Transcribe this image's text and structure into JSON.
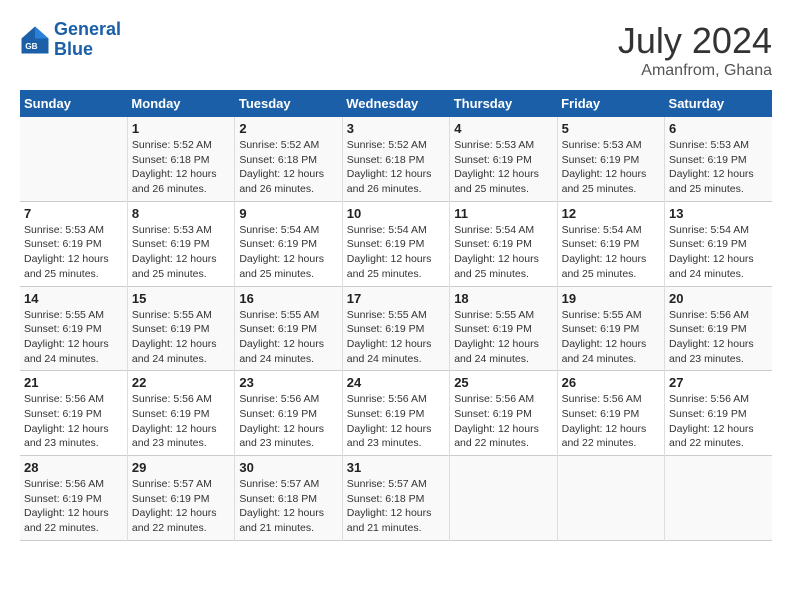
{
  "header": {
    "logo_line1": "General",
    "logo_line2": "Blue",
    "title": "July 2024",
    "subtitle": "Amanfrom, Ghana"
  },
  "weekdays": [
    "Sunday",
    "Monday",
    "Tuesday",
    "Wednesday",
    "Thursday",
    "Friday",
    "Saturday"
  ],
  "weeks": [
    [
      null,
      {
        "day": "1",
        "sunrise": "5:52 AM",
        "sunset": "6:18 PM",
        "daylight": "12 hours and 26 minutes."
      },
      {
        "day": "2",
        "sunrise": "5:52 AM",
        "sunset": "6:18 PM",
        "daylight": "12 hours and 26 minutes."
      },
      {
        "day": "3",
        "sunrise": "5:52 AM",
        "sunset": "6:18 PM",
        "daylight": "12 hours and 26 minutes."
      },
      {
        "day": "4",
        "sunrise": "5:53 AM",
        "sunset": "6:19 PM",
        "daylight": "12 hours and 25 minutes."
      },
      {
        "day": "5",
        "sunrise": "5:53 AM",
        "sunset": "6:19 PM",
        "daylight": "12 hours and 25 minutes."
      },
      {
        "day": "6",
        "sunrise": "5:53 AM",
        "sunset": "6:19 PM",
        "daylight": "12 hours and 25 minutes."
      }
    ],
    [
      {
        "day": "7",
        "sunrise": "5:53 AM",
        "sunset": "6:19 PM",
        "daylight": "12 hours and 25 minutes."
      },
      {
        "day": "8",
        "sunrise": "5:53 AM",
        "sunset": "6:19 PM",
        "daylight": "12 hours and 25 minutes."
      },
      {
        "day": "9",
        "sunrise": "5:54 AM",
        "sunset": "6:19 PM",
        "daylight": "12 hours and 25 minutes."
      },
      {
        "day": "10",
        "sunrise": "5:54 AM",
        "sunset": "6:19 PM",
        "daylight": "12 hours and 25 minutes."
      },
      {
        "day": "11",
        "sunrise": "5:54 AM",
        "sunset": "6:19 PM",
        "daylight": "12 hours and 25 minutes."
      },
      {
        "day": "12",
        "sunrise": "5:54 AM",
        "sunset": "6:19 PM",
        "daylight": "12 hours and 25 minutes."
      },
      {
        "day": "13",
        "sunrise": "5:54 AM",
        "sunset": "6:19 PM",
        "daylight": "12 hours and 24 minutes."
      }
    ],
    [
      {
        "day": "14",
        "sunrise": "5:55 AM",
        "sunset": "6:19 PM",
        "daylight": "12 hours and 24 minutes."
      },
      {
        "day": "15",
        "sunrise": "5:55 AM",
        "sunset": "6:19 PM",
        "daylight": "12 hours and 24 minutes."
      },
      {
        "day": "16",
        "sunrise": "5:55 AM",
        "sunset": "6:19 PM",
        "daylight": "12 hours and 24 minutes."
      },
      {
        "day": "17",
        "sunrise": "5:55 AM",
        "sunset": "6:19 PM",
        "daylight": "12 hours and 24 minutes."
      },
      {
        "day": "18",
        "sunrise": "5:55 AM",
        "sunset": "6:19 PM",
        "daylight": "12 hours and 24 minutes."
      },
      {
        "day": "19",
        "sunrise": "5:55 AM",
        "sunset": "6:19 PM",
        "daylight": "12 hours and 24 minutes."
      },
      {
        "day": "20",
        "sunrise": "5:56 AM",
        "sunset": "6:19 PM",
        "daylight": "12 hours and 23 minutes."
      }
    ],
    [
      {
        "day": "21",
        "sunrise": "5:56 AM",
        "sunset": "6:19 PM",
        "daylight": "12 hours and 23 minutes."
      },
      {
        "day": "22",
        "sunrise": "5:56 AM",
        "sunset": "6:19 PM",
        "daylight": "12 hours and 23 minutes."
      },
      {
        "day": "23",
        "sunrise": "5:56 AM",
        "sunset": "6:19 PM",
        "daylight": "12 hours and 23 minutes."
      },
      {
        "day": "24",
        "sunrise": "5:56 AM",
        "sunset": "6:19 PM",
        "daylight": "12 hours and 23 minutes."
      },
      {
        "day": "25",
        "sunrise": "5:56 AM",
        "sunset": "6:19 PM",
        "daylight": "12 hours and 22 minutes."
      },
      {
        "day": "26",
        "sunrise": "5:56 AM",
        "sunset": "6:19 PM",
        "daylight": "12 hours and 22 minutes."
      },
      {
        "day": "27",
        "sunrise": "5:56 AM",
        "sunset": "6:19 PM",
        "daylight": "12 hours and 22 minutes."
      }
    ],
    [
      {
        "day": "28",
        "sunrise": "5:56 AM",
        "sunset": "6:19 PM",
        "daylight": "12 hours and 22 minutes."
      },
      {
        "day": "29",
        "sunrise": "5:57 AM",
        "sunset": "6:19 PM",
        "daylight": "12 hours and 22 minutes."
      },
      {
        "day": "30",
        "sunrise": "5:57 AM",
        "sunset": "6:18 PM",
        "daylight": "12 hours and 21 minutes."
      },
      {
        "day": "31",
        "sunrise": "5:57 AM",
        "sunset": "6:18 PM",
        "daylight": "12 hours and 21 minutes."
      },
      null,
      null,
      null
    ]
  ]
}
